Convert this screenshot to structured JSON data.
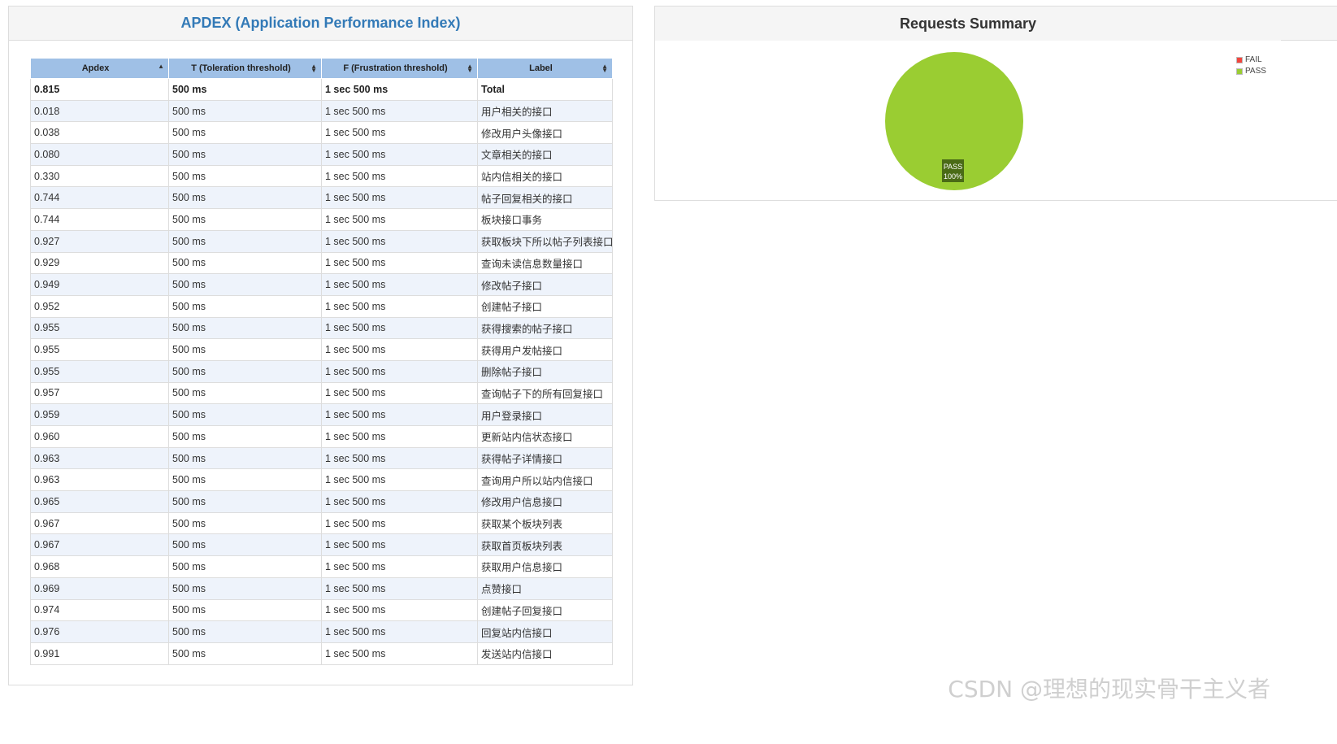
{
  "apdex_panel": {
    "title": "APDEX (Application Performance Index)",
    "columns": [
      {
        "label": "Apdex",
        "sort_icon": "sort-asc-icon"
      },
      {
        "label": "T (Toleration threshold)",
        "sort_icon": "sort-both-icon"
      },
      {
        "label": "F (Frustration threshold)",
        "sort_icon": "sort-both-icon"
      },
      {
        "label": "Label",
        "sort_icon": "sort-both-icon"
      }
    ],
    "rows": [
      {
        "apdex": "0.815",
        "t": "500 ms",
        "f": "1 sec 500 ms",
        "label": "Total"
      },
      {
        "apdex": "0.018",
        "t": "500 ms",
        "f": "1 sec 500 ms",
        "label": "用户相关的接口"
      },
      {
        "apdex": "0.038",
        "t": "500 ms",
        "f": "1 sec 500 ms",
        "label": "修改用户头像接口"
      },
      {
        "apdex": "0.080",
        "t": "500 ms",
        "f": "1 sec 500 ms",
        "label": "文章相关的接口"
      },
      {
        "apdex": "0.330",
        "t": "500 ms",
        "f": "1 sec 500 ms",
        "label": "站内信相关的接口"
      },
      {
        "apdex": "0.744",
        "t": "500 ms",
        "f": "1 sec 500 ms",
        "label": "帖子回复相关的接口"
      },
      {
        "apdex": "0.744",
        "t": "500 ms",
        "f": "1 sec 500 ms",
        "label": "板块接口事务"
      },
      {
        "apdex": "0.927",
        "t": "500 ms",
        "f": "1 sec 500 ms",
        "label": "获取板块下所以帖子列表接口"
      },
      {
        "apdex": "0.929",
        "t": "500 ms",
        "f": "1 sec 500 ms",
        "label": "查询未读信息数量接口"
      },
      {
        "apdex": "0.949",
        "t": "500 ms",
        "f": "1 sec 500 ms",
        "label": "修改帖子接口"
      },
      {
        "apdex": "0.952",
        "t": "500 ms",
        "f": "1 sec 500 ms",
        "label": "创建帖子接口"
      },
      {
        "apdex": "0.955",
        "t": "500 ms",
        "f": "1 sec 500 ms",
        "label": "获得搜索的帖子接口"
      },
      {
        "apdex": "0.955",
        "t": "500 ms",
        "f": "1 sec 500 ms",
        "label": "获得用户发帖接口"
      },
      {
        "apdex": "0.955",
        "t": "500 ms",
        "f": "1 sec 500 ms",
        "label": "删除帖子接口"
      },
      {
        "apdex": "0.957",
        "t": "500 ms",
        "f": "1 sec 500 ms",
        "label": "查询帖子下的所有回复接口"
      },
      {
        "apdex": "0.959",
        "t": "500 ms",
        "f": "1 sec 500 ms",
        "label": "用户登录接口"
      },
      {
        "apdex": "0.960",
        "t": "500 ms",
        "f": "1 sec 500 ms",
        "label": "更新站内信状态接口"
      },
      {
        "apdex": "0.963",
        "t": "500 ms",
        "f": "1 sec 500 ms",
        "label": "获得帖子详情接口"
      },
      {
        "apdex": "0.963",
        "t": "500 ms",
        "f": "1 sec 500 ms",
        "label": "查询用户所以站内信接口"
      },
      {
        "apdex": "0.965",
        "t": "500 ms",
        "f": "1 sec 500 ms",
        "label": "修改用户信息接口"
      },
      {
        "apdex": "0.967",
        "t": "500 ms",
        "f": "1 sec 500 ms",
        "label": "获取某个板块列表"
      },
      {
        "apdex": "0.967",
        "t": "500 ms",
        "f": "1 sec 500 ms",
        "label": "获取首页板块列表"
      },
      {
        "apdex": "0.968",
        "t": "500 ms",
        "f": "1 sec 500 ms",
        "label": "获取用户信息接口"
      },
      {
        "apdex": "0.969",
        "t": "500 ms",
        "f": "1 sec 500 ms",
        "label": "点赞接口"
      },
      {
        "apdex": "0.974",
        "t": "500 ms",
        "f": "1 sec 500 ms",
        "label": "创建帖子回复接口"
      },
      {
        "apdex": "0.976",
        "t": "500 ms",
        "f": "1 sec 500 ms",
        "label": "回复站内信接口"
      },
      {
        "apdex": "0.991",
        "t": "500 ms",
        "f": "1 sec 500 ms",
        "label": "发送站内信接口"
      }
    ]
  },
  "requests_panel": {
    "title": "Requests Summary",
    "legend": [
      {
        "label": "FAIL",
        "color": "#f2453d"
      },
      {
        "label": "PASS",
        "color": "#9acd32"
      }
    ]
  },
  "chart_data": {
    "type": "pie",
    "title": "Requests Summary",
    "categories": [
      "FAIL",
      "PASS"
    ],
    "values": [
      0,
      100
    ],
    "colors": [
      "#f2453d",
      "#9acd32"
    ],
    "slice_label": {
      "name": "PASS",
      "value": "100%"
    },
    "legend_position": "top-right"
  },
  "watermark": "CSDN @理想的现实骨干主义者"
}
